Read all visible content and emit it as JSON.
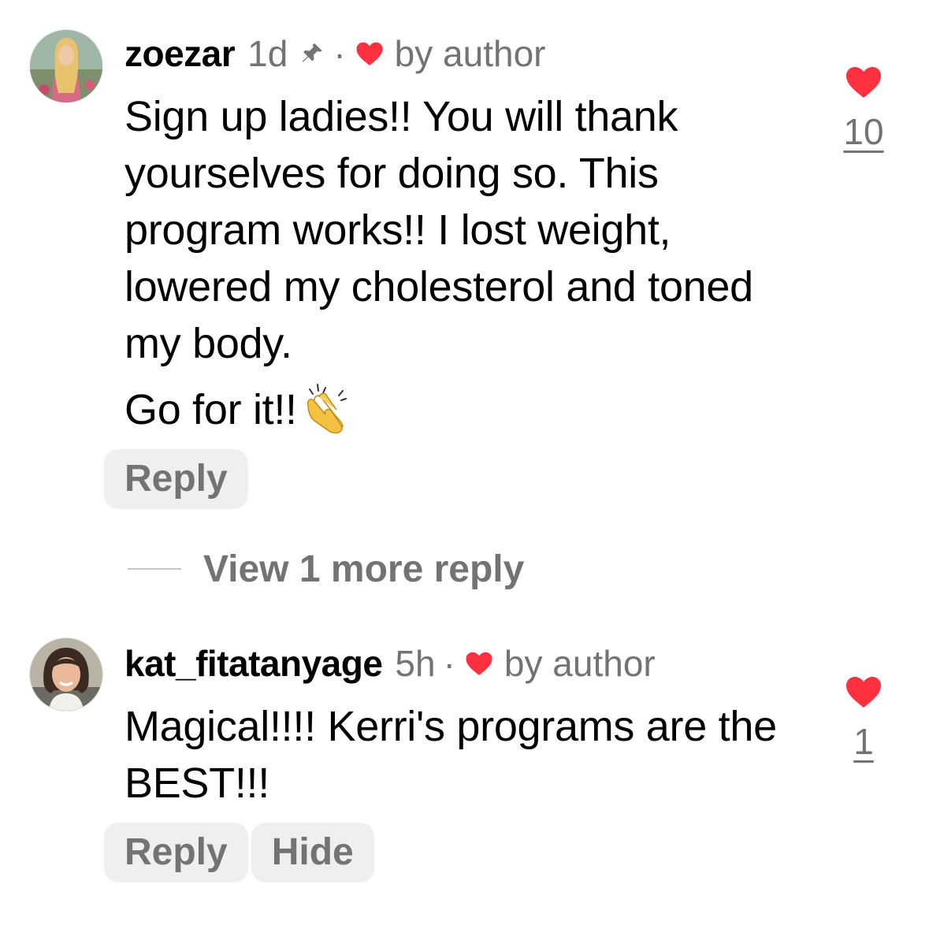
{
  "comments": [
    {
      "username": "zoezar",
      "time": "1d",
      "pinned": true,
      "separator": "·",
      "liked_by_author": true,
      "by_author_label": "by author",
      "text_paragraphs": [
        "Sign up ladies!! You will thank yourselves for doing so. This program works!! I lost weight, lowered my cholesterol and toned my body.",
        "Go for it!!"
      ],
      "emoji": "clapping-hands",
      "likes": "10",
      "actions": [
        "Reply"
      ]
    },
    {
      "username": "kat_fitatanyage",
      "time": "5h",
      "pinned": false,
      "separator": "·",
      "liked_by_author": true,
      "by_author_label": "by author",
      "text_paragraphs": [
        "Magical!!!! Kerri's programs are the BEST!!!"
      ],
      "likes": "1",
      "actions": [
        "Reply",
        "Hide"
      ]
    }
  ],
  "view_replies_label": "View 1 more reply",
  "colors": {
    "like_red": "#ff3040",
    "secondary_text": "#737373",
    "button_bg": "#efefef"
  },
  "icons": {
    "pin": "pin-icon",
    "heart": "heart-icon"
  }
}
